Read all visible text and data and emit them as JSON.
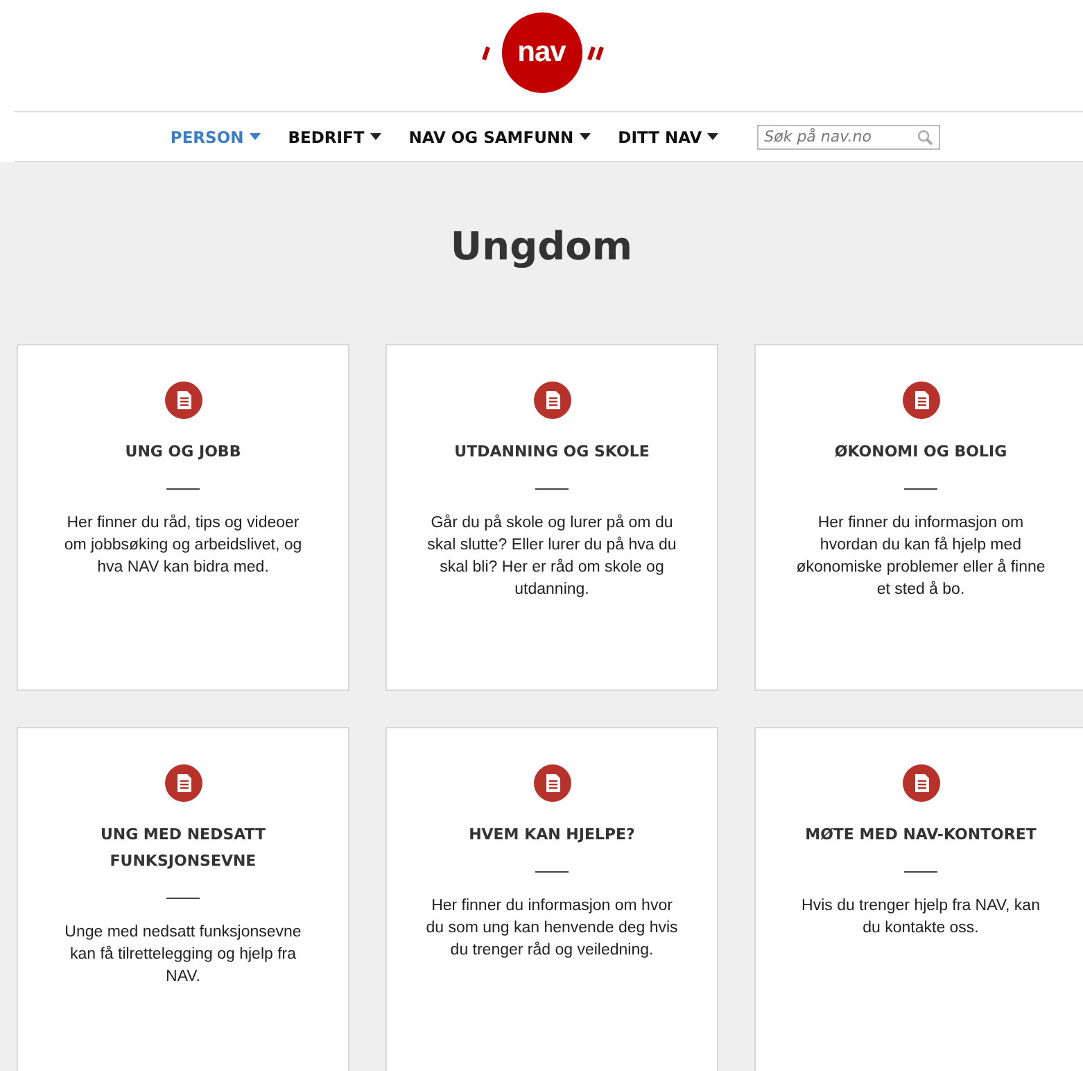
{
  "logo": {
    "text": "nav"
  },
  "nav": {
    "items": [
      {
        "label": "PERSON",
        "selected": true
      },
      {
        "label": "BEDRIFT",
        "selected": false
      },
      {
        "label": "NAV OG SAMFUNN",
        "selected": false
      },
      {
        "label": "DITT NAV",
        "selected": false
      }
    ],
    "search": {
      "placeholder": "Søk på nav.no"
    }
  },
  "page_title": "Ungdom",
  "cards": [
    {
      "title": "UNG OG JOBB",
      "text": "Her finner du råd, tips og videoer om jobbsøking og arbeidslivet, og hva NAV kan bidra med."
    },
    {
      "title": "UTDANNING OG SKOLE",
      "text": "Går du på skole og lurer på om du skal slutte? Eller lurer du på hva du skal bli? Her er råd om skole og utdanning."
    },
    {
      "title": "ØKONOMI OG BOLIG",
      "text": "Her finner du informasjon om hvordan du kan få hjelp med økonomiske problemer eller å finne et sted å bo."
    },
    {
      "title": "UNG MED NEDSATT FUNKSJONSEVNE",
      "text": "Unge med nedsatt funksjonsevne kan få tilrettelegging og hjelp fra NAV."
    },
    {
      "title": "HVEM KAN HJELPE?",
      "text": "Her finner du informasjon om hvor du som ung kan henvende deg hvis du trenger råd og veiledning."
    },
    {
      "title": "MØTE MED NAV-KONTORET",
      "text": "Hvis du trenger hjelp fra NAV, kan du kontakte oss."
    }
  ]
}
